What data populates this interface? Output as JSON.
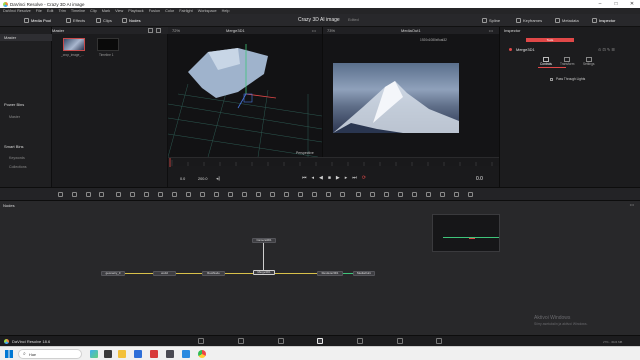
{
  "window": {
    "title": "DaVinci Resolve - Crazy 3D AI image"
  },
  "menu": [
    "DaVinci Resolve",
    "File",
    "Edit",
    "Trim",
    "Timeline",
    "Clip",
    "Mark",
    "View",
    "Playback",
    "Fusion",
    "Color",
    "Fairlight",
    "Workspace",
    "Help"
  ],
  "toolbar": {
    "media_pool": "Media Pool",
    "effects": "Effects",
    "clips": "Clips",
    "nodes": "Nodes",
    "project_title": "Crazy 3D AI image",
    "edited": "Edited",
    "spline": "Spline",
    "keyframes": "Keyframes",
    "metadata": "Metadata",
    "inspector": "Inspector"
  },
  "media_pool": {
    "root_bin": "Master",
    "header_bin": "Master",
    "power_bins": "Power Bins",
    "power_master": "Master",
    "smart_bins": "Smart Bins",
    "keywords": "Keywords",
    "collections": "Collections",
    "clips": [
      {
        "label": "_crop_image_..."
      },
      {
        "label": "Timeline 1"
      }
    ]
  },
  "viewer_left": {
    "zoom": "72%",
    "node": "Merge3D1",
    "label": "Perspective"
  },
  "viewer_right": {
    "zoom": "73%",
    "node": "MediaOut1",
    "resolution": "1920x1080xfloat32"
  },
  "inspector": {
    "title": "Inspector",
    "node": "Merge3D1",
    "tabs": [
      "Controls",
      "Transform",
      "Settings"
    ],
    "active_tab": "Controls",
    "tool_tab": "Tools",
    "pass_through": "Pass Through Lights"
  },
  "transport": {
    "start": "0.0",
    "end": "200.0",
    "current": "0.0"
  },
  "nodes_panel": {
    "title": "Nodes",
    "nodes": {
      "camera": "Camera3D1",
      "geometry": "geometry_0",
      "world": "world",
      "root": "RootNode",
      "merge": "Merge3D1",
      "renderer": "Renderer3D1",
      "media_out": "MediaOut1"
    }
  },
  "windows_watermark": {
    "line1": "Aktivoi Windows",
    "line2": "Siirry asetuksiin ja aktivoi Windows."
  },
  "status": {
    "app_version": "DaVinci Resolve 18.6",
    "usage": "27% - 3024 MB"
  },
  "taskbar": {
    "search_placeholder": "Hae"
  },
  "colors": {
    "accent_red": "#e04848",
    "wire_yellow": "#d8c04a",
    "wire_green": "#3fc47a"
  }
}
